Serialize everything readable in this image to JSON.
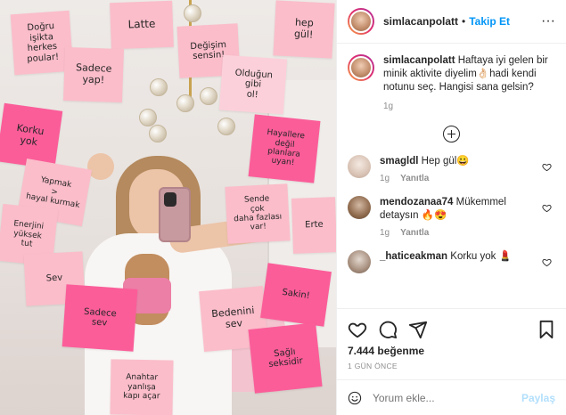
{
  "post": {
    "author": "simlacanpolatt",
    "follow_label": "Takip Et",
    "separator": "•",
    "more_label": "···",
    "caption": "Haftaya iyi gelen bir minik aktivite diyelim👌🏻hadi kendi notunu seç. Hangisi sana gelsin?",
    "caption_time": "1g",
    "likes": "7.444 beğenme",
    "date": "1 GÜN ÖNCE",
    "comment_placeholder": "Yorum ekle...",
    "post_label": "Paylaş"
  },
  "comments": [
    {
      "user": "smagldl",
      "text": "Hep gül😀",
      "time": "1g",
      "reply": "Yanıtla"
    },
    {
      "user": "mendozanaa74",
      "text": "Mükemmel detaysın 🔥😍",
      "time": "1g",
      "reply": "Yanıtla"
    },
    {
      "user": "_haticeakman",
      "text": "Korku yok 💄"
    }
  ],
  "notes": [
    {
      "text": "Doğru\nişikta herkes\npoular!",
      "tone": "light"
    },
    {
      "text": "Latte",
      "tone": "light"
    },
    {
      "text": "hep\ngül!",
      "tone": "light"
    },
    {
      "text": "Sadece\nyap!",
      "tone": "light"
    },
    {
      "text": "Değişim\nsensin!",
      "tone": "light"
    },
    {
      "text": "Olduğun\ngibi\nol!",
      "tone": "soft"
    },
    {
      "text": "Korku\nyok",
      "tone": "bright"
    },
    {
      "text": "Hayallere\ndeğil\nplanlara\nuyan!",
      "tone": "bright"
    },
    {
      "text": "Yapmak\n>\nhayal kurmak",
      "tone": "light"
    },
    {
      "text": "Sende\nçok\ndaha fazlası\nvar!",
      "tone": "light"
    },
    {
      "text": "Enerjini\nyüksek\ntut",
      "tone": "light"
    },
    {
      "text": "Erte",
      "tone": "light"
    },
    {
      "text": "Sev",
      "tone": "light"
    },
    {
      "text": "Sadece\nsev",
      "tone": "bright"
    },
    {
      "text": "Bedenini\nsev",
      "tone": "light"
    },
    {
      "text": "Sakin!",
      "tone": "bright"
    },
    {
      "text": "Sağlı\nseksidir",
      "tone": "bright"
    },
    {
      "text": "Anahtar\nyanlışa\nkapı açar",
      "tone": "light"
    }
  ]
}
